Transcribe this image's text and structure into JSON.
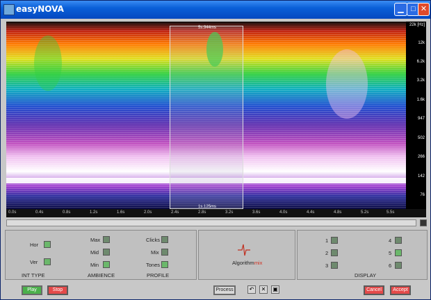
{
  "window": {
    "title": "easyNOVA"
  },
  "spectrogram": {
    "selection_top": "5s.944ms",
    "selection_bottom": "1s.125ms",
    "freq_labels": [
      "22k\n[Hz]",
      "12k",
      "6.2k",
      "3.2k",
      "1.6k",
      "947",
      "502",
      "266",
      "142",
      "76",
      "41"
    ],
    "time_ticks": [
      "0.0s",
      "0.4s",
      "0.8s",
      "1.2s",
      "1.6s",
      "2.0s",
      "2.4s",
      "2.8s",
      "3.2s",
      "3.6s",
      "4.0s",
      "4.4s",
      "4.8s",
      "5.2s",
      "5.5s"
    ]
  },
  "panels": {
    "int_type": {
      "title": "INT TYPE",
      "hor": "Hor",
      "ver": "Ver"
    },
    "ambience": {
      "title": "AMBIENCE",
      "max": "Max",
      "mid": "Mid",
      "min": "Min"
    },
    "profile": {
      "title": "PROFILE",
      "clicks": "Clicks",
      "mix": "Mix",
      "tones": "Tones"
    },
    "algorithm": {
      "name_a": "Algorithm",
      "name_b": "mix"
    },
    "display": {
      "title": "DISPLAY",
      "items": [
        "1",
        "2",
        "3",
        "4",
        "5",
        "6"
      ]
    }
  },
  "buttons": {
    "play": "Play",
    "stop": "Stop",
    "process": "Process",
    "cancel": "Cancel",
    "accept": "Accept"
  },
  "colors": {
    "accent_red": "#e34a4a",
    "accent_green": "#4bb04b",
    "title_blue": "#0a5fd8"
  }
}
